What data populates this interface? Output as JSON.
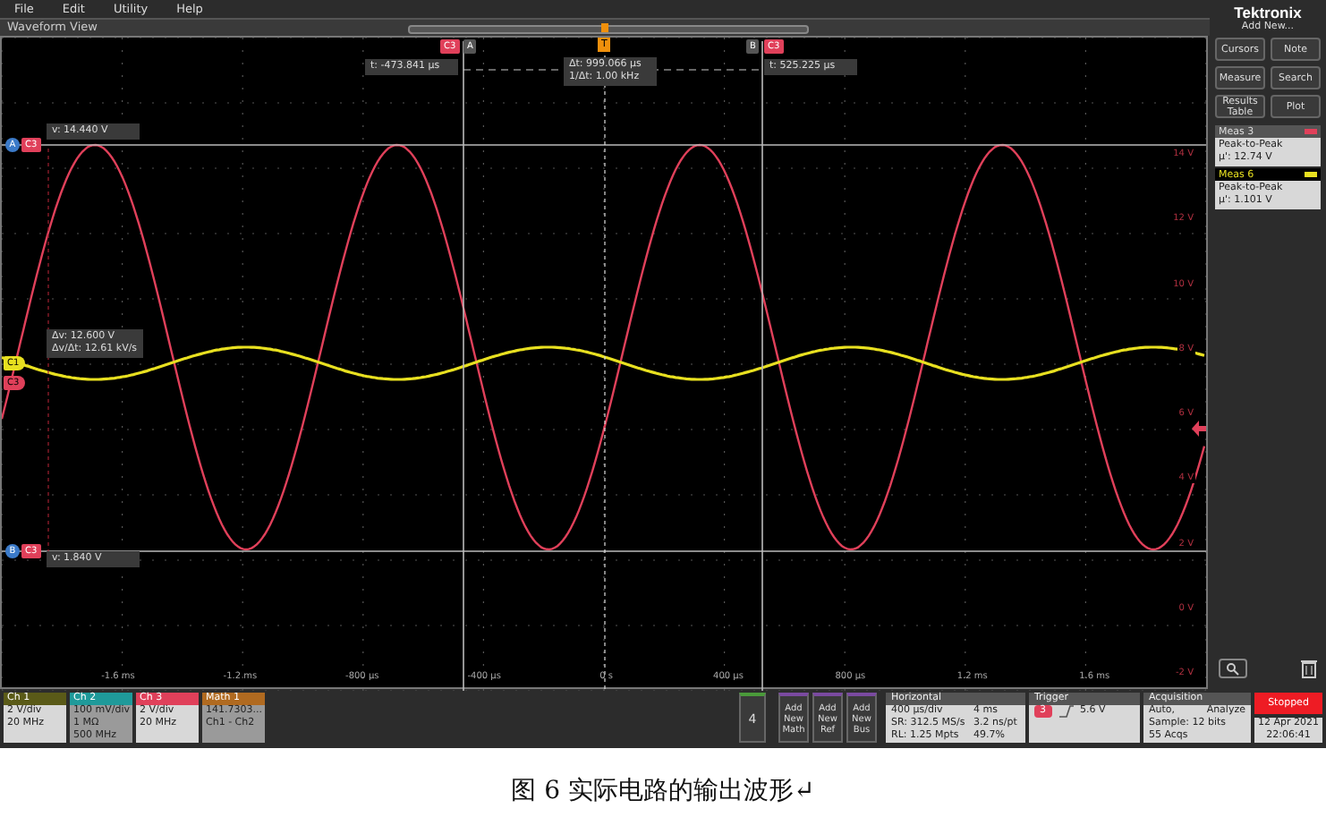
{
  "menu": [
    "File",
    "Edit",
    "Utility",
    "Help"
  ],
  "view_title": "Waveform View",
  "overview": {
    "level": 0.49
  },
  "trigger_marker": "T",
  "cursor_a": {
    "tag": "A",
    "channel": "C3",
    "left_tag": "A",
    "left_channel": "C3",
    "time": "t: -473.841 µs",
    "value": "v: 14.440 V"
  },
  "cursor_b": {
    "tag": "B",
    "channel": "C3",
    "left_tag": "B",
    "left_channel": "C3",
    "time": "t: 525.225 µs",
    "value": "v: 1.840 V"
  },
  "delta": {
    "time": "Δt: 999.066 µs",
    "freq": "1/Δt: 1.00 kHz",
    "volt": "Δv: 12.600 V",
    "slope": "Δv/Δt: 12.61 kV/s"
  },
  "left_markers": [
    {
      "label": "C1",
      "color": "#e8e020"
    },
    {
      "label": "C3",
      "color": "#e0405a"
    }
  ],
  "y_labels": [
    "14 V",
    "12 V",
    "10 V",
    "8 V",
    "6 V",
    "4 V",
    "2 V",
    "0 V",
    "-2 V"
  ],
  "x_labels": [
    "-1.6 ms",
    "-1.2 ms",
    "-800 µs",
    "-400 µs",
    "0 s",
    "400 µs",
    "800 µs",
    "1.2 ms",
    "1.6 ms"
  ],
  "brand": "Tektronix",
  "add_new": "Add New...",
  "panel_buttons": [
    "Cursors",
    "Note",
    "Measure",
    "Search",
    "Results Table",
    "Plot"
  ],
  "measurements": [
    {
      "title": "Meas 3",
      "name": "Peak-to-Peak",
      "value": "µ': 12.74 V",
      "color": "#e0405a",
      "selected": false
    },
    {
      "title": "Meas 6",
      "name": "Peak-to-Peak",
      "value": "µ': 1.101 V",
      "color": "#e8e020",
      "selected": true
    }
  ],
  "channels": [
    {
      "title": "Ch 1",
      "color": "#5a5a18",
      "active": true,
      "lines": [
        "2 V/div",
        "20 MHz"
      ]
    },
    {
      "title": "Ch 2",
      "color": "#1f9a9a",
      "active": false,
      "lines": [
        "100 mV/div",
        "1 MΩ",
        "500 MHz"
      ]
    },
    {
      "title": "Ch 3",
      "color": "#e0405a",
      "active": true,
      "lines": [
        "2 V/div",
        "20 MHz"
      ]
    },
    {
      "title": "Math 1",
      "color": "#b06a20",
      "active": false,
      "lines": [
        "141.7303...",
        "Ch1 - Ch2"
      ]
    }
  ],
  "more_button": "4",
  "add_buttons": [
    "Add New Math",
    "Add New Ref",
    "Add New Bus"
  ],
  "horizontal": {
    "title": "Horizontal",
    "rows": [
      [
        "400 µs/div",
        "4 ms"
      ],
      [
        "SR: 312.5 MS/s",
        "3.2 ns/pt"
      ],
      [
        "RL: 1.25 Mpts",
        "49.7%"
      ]
    ]
  },
  "trigger": {
    "title": "Trigger",
    "source": "3",
    "level": "5.6 V"
  },
  "acquisition": {
    "title": "Acquisition",
    "mode": "Auto,",
    "action": "Analyze",
    "lines": [
      "Sample: 12 bits",
      "55 Acqs"
    ]
  },
  "status": "Stopped",
  "date": "12 Apr 2021",
  "clock": "22:06:41",
  "caption": "图 6 实际电路的输出波形↵"
}
